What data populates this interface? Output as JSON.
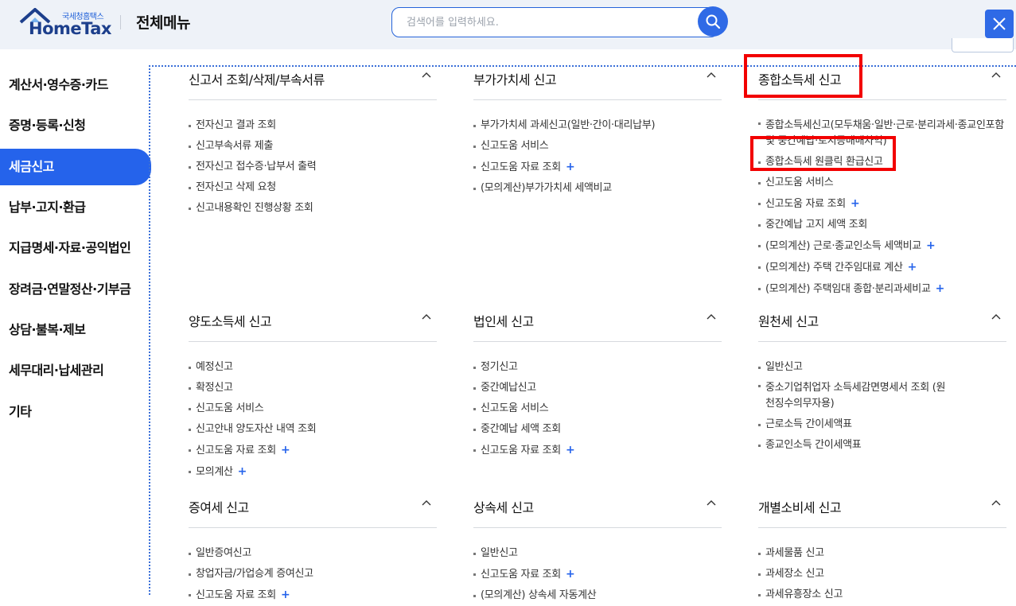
{
  "header": {
    "logo_small": "국세청홈택스",
    "logo_big": "HomeTax",
    "title": "전체메뉴",
    "search_placeholder": "검색어를 입력하세요."
  },
  "sidebar": {
    "items": [
      {
        "label": "계산서·영수증·카드"
      },
      {
        "label": "증명·등록·신청"
      },
      {
        "label": "세금신고"
      },
      {
        "label": "납부·고지·환급"
      },
      {
        "label": "지급명세·자료·공익법인"
      },
      {
        "label": "장려금·연말정산·기부금"
      },
      {
        "label": "상담·불복·제보"
      },
      {
        "label": "세무대리·납세관리"
      },
      {
        "label": "기타"
      }
    ]
  },
  "sections": [
    {
      "title": "신고서 조회/삭제/부속서류",
      "items": [
        {
          "label": "전자신고 결과 조회",
          "plus": ""
        },
        {
          "label": "신고부속서류 제출",
          "plus": ""
        },
        {
          "label": "전자신고 접수증·납부서 출력",
          "plus": ""
        },
        {
          "label": "전자신고 삭제 요청",
          "plus": ""
        },
        {
          "label": "신고내용확인 진행상황 조회",
          "plus": ""
        }
      ]
    },
    {
      "title": "부가가치세 신고",
      "items": [
        {
          "label": "부가가치세 과세신고(일반·간이·대리납부)",
          "plus": ""
        },
        {
          "label": "신고도움 서비스",
          "plus": ""
        },
        {
          "label": "신고도움 자료 조회",
          "plus": "+"
        },
        {
          "label": "(모의계산)부가가치세 세액비교",
          "plus": ""
        }
      ]
    },
    {
      "title": "종합소득세 신고",
      "items": [
        {
          "label": "종합소득세신고(모두채움·일반·근로·분리과세·종교인포함 및 중간예납·토지등매매차익)",
          "plus": ""
        },
        {
          "label": "종합소득세 원클릭 환급신고",
          "plus": ""
        },
        {
          "label": "신고도움 서비스",
          "plus": ""
        },
        {
          "label": "신고도움 자료 조회",
          "plus": "+"
        },
        {
          "label": "중간예납 고지 세액 조회",
          "plus": ""
        },
        {
          "label": "(모의계산) 근로·종교인소득 세액비교",
          "plus": "+"
        },
        {
          "label": "(모의계산) 주택 간주임대료 계산",
          "plus": "+"
        },
        {
          "label": "(모의계산) 주택임대 종합·분리과세비교",
          "plus": "+"
        }
      ]
    },
    {
      "title": "양도소득세 신고",
      "items": [
        {
          "label": "예정신고",
          "plus": ""
        },
        {
          "label": "확정신고",
          "plus": ""
        },
        {
          "label": "신고도움 서비스",
          "plus": ""
        },
        {
          "label": "신고안내 양도자산 내역 조회",
          "plus": ""
        },
        {
          "label": "신고도움 자료 조회",
          "plus": "+"
        },
        {
          "label": "모의계산",
          "plus": "+"
        }
      ]
    },
    {
      "title": "법인세 신고",
      "items": [
        {
          "label": "정기신고",
          "plus": ""
        },
        {
          "label": "중간예납신고",
          "plus": ""
        },
        {
          "label": "신고도움 서비스",
          "plus": ""
        },
        {
          "label": "중간예납 세액 조회",
          "plus": ""
        },
        {
          "label": "신고도움 자료 조회",
          "plus": "+"
        }
      ]
    },
    {
      "title": "원천세 신고",
      "items": [
        {
          "label": "일반신고",
          "plus": ""
        },
        {
          "label": "중소기업취업자 소득세감면명세서 조회 (원천징수의무자용)",
          "plus": ""
        },
        {
          "label": "근로소득 간이세액표",
          "plus": ""
        },
        {
          "label": "종교인소득 간이세액표",
          "plus": ""
        }
      ]
    },
    {
      "title": "증여세 신고",
      "items": [
        {
          "label": "일반증여신고",
          "plus": ""
        },
        {
          "label": "창업자금/가업승계 증여신고",
          "plus": ""
        },
        {
          "label": "신고도움 자료 조회",
          "plus": "+"
        }
      ]
    },
    {
      "title": "상속세 신고",
      "items": [
        {
          "label": "일반신고",
          "plus": ""
        },
        {
          "label": "신고도움 자료 조회",
          "plus": "+"
        },
        {
          "label": "(모의계산) 상속세 자동계산",
          "plus": ""
        }
      ]
    },
    {
      "title": "개별소비세 신고",
      "items": [
        {
          "label": "과세물품 신고",
          "plus": ""
        },
        {
          "label": "과세장소 신고",
          "plus": ""
        },
        {
          "label": "과세유흥장소 신고",
          "plus": ""
        }
      ]
    }
  ],
  "colors": {
    "accent": "#2563eb",
    "highlight": "#f20000",
    "header_bg": "#eef2f8"
  }
}
